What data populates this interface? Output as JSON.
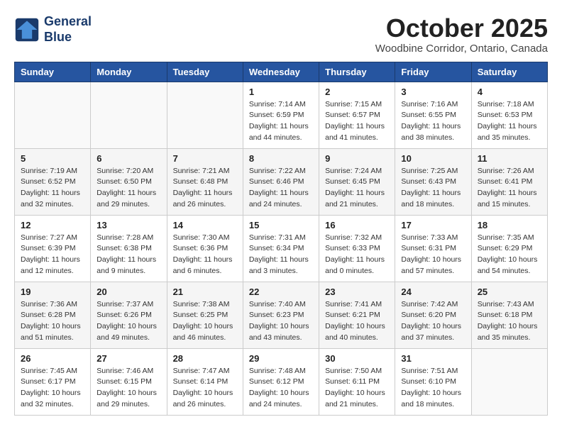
{
  "header": {
    "logo_line1": "General",
    "logo_line2": "Blue",
    "month": "October 2025",
    "location": "Woodbine Corridor, Ontario, Canada"
  },
  "weekdays": [
    "Sunday",
    "Monday",
    "Tuesday",
    "Wednesday",
    "Thursday",
    "Friday",
    "Saturday"
  ],
  "weeks": [
    [
      {
        "day": "",
        "info": ""
      },
      {
        "day": "",
        "info": ""
      },
      {
        "day": "",
        "info": ""
      },
      {
        "day": "1",
        "info": "Sunrise: 7:14 AM\nSunset: 6:59 PM\nDaylight: 11 hours and 44 minutes."
      },
      {
        "day": "2",
        "info": "Sunrise: 7:15 AM\nSunset: 6:57 PM\nDaylight: 11 hours and 41 minutes."
      },
      {
        "day": "3",
        "info": "Sunrise: 7:16 AM\nSunset: 6:55 PM\nDaylight: 11 hours and 38 minutes."
      },
      {
        "day": "4",
        "info": "Sunrise: 7:18 AM\nSunset: 6:53 PM\nDaylight: 11 hours and 35 minutes."
      }
    ],
    [
      {
        "day": "5",
        "info": "Sunrise: 7:19 AM\nSunset: 6:52 PM\nDaylight: 11 hours and 32 minutes."
      },
      {
        "day": "6",
        "info": "Sunrise: 7:20 AM\nSunset: 6:50 PM\nDaylight: 11 hours and 29 minutes."
      },
      {
        "day": "7",
        "info": "Sunrise: 7:21 AM\nSunset: 6:48 PM\nDaylight: 11 hours and 26 minutes."
      },
      {
        "day": "8",
        "info": "Sunrise: 7:22 AM\nSunset: 6:46 PM\nDaylight: 11 hours and 24 minutes."
      },
      {
        "day": "9",
        "info": "Sunrise: 7:24 AM\nSunset: 6:45 PM\nDaylight: 11 hours and 21 minutes."
      },
      {
        "day": "10",
        "info": "Sunrise: 7:25 AM\nSunset: 6:43 PM\nDaylight: 11 hours and 18 minutes."
      },
      {
        "day": "11",
        "info": "Sunrise: 7:26 AM\nSunset: 6:41 PM\nDaylight: 11 hours and 15 minutes."
      }
    ],
    [
      {
        "day": "12",
        "info": "Sunrise: 7:27 AM\nSunset: 6:39 PM\nDaylight: 11 hours and 12 minutes."
      },
      {
        "day": "13",
        "info": "Sunrise: 7:28 AM\nSunset: 6:38 PM\nDaylight: 11 hours and 9 minutes."
      },
      {
        "day": "14",
        "info": "Sunrise: 7:30 AM\nSunset: 6:36 PM\nDaylight: 11 hours and 6 minutes."
      },
      {
        "day": "15",
        "info": "Sunrise: 7:31 AM\nSunset: 6:34 PM\nDaylight: 11 hours and 3 minutes."
      },
      {
        "day": "16",
        "info": "Sunrise: 7:32 AM\nSunset: 6:33 PM\nDaylight: 11 hours and 0 minutes."
      },
      {
        "day": "17",
        "info": "Sunrise: 7:33 AM\nSunset: 6:31 PM\nDaylight: 10 hours and 57 minutes."
      },
      {
        "day": "18",
        "info": "Sunrise: 7:35 AM\nSunset: 6:29 PM\nDaylight: 10 hours and 54 minutes."
      }
    ],
    [
      {
        "day": "19",
        "info": "Sunrise: 7:36 AM\nSunset: 6:28 PM\nDaylight: 10 hours and 51 minutes."
      },
      {
        "day": "20",
        "info": "Sunrise: 7:37 AM\nSunset: 6:26 PM\nDaylight: 10 hours and 49 minutes."
      },
      {
        "day": "21",
        "info": "Sunrise: 7:38 AM\nSunset: 6:25 PM\nDaylight: 10 hours and 46 minutes."
      },
      {
        "day": "22",
        "info": "Sunrise: 7:40 AM\nSunset: 6:23 PM\nDaylight: 10 hours and 43 minutes."
      },
      {
        "day": "23",
        "info": "Sunrise: 7:41 AM\nSunset: 6:21 PM\nDaylight: 10 hours and 40 minutes."
      },
      {
        "day": "24",
        "info": "Sunrise: 7:42 AM\nSunset: 6:20 PM\nDaylight: 10 hours and 37 minutes."
      },
      {
        "day": "25",
        "info": "Sunrise: 7:43 AM\nSunset: 6:18 PM\nDaylight: 10 hours and 35 minutes."
      }
    ],
    [
      {
        "day": "26",
        "info": "Sunrise: 7:45 AM\nSunset: 6:17 PM\nDaylight: 10 hours and 32 minutes."
      },
      {
        "day": "27",
        "info": "Sunrise: 7:46 AM\nSunset: 6:15 PM\nDaylight: 10 hours and 29 minutes."
      },
      {
        "day": "28",
        "info": "Sunrise: 7:47 AM\nSunset: 6:14 PM\nDaylight: 10 hours and 26 minutes."
      },
      {
        "day": "29",
        "info": "Sunrise: 7:48 AM\nSunset: 6:12 PM\nDaylight: 10 hours and 24 minutes."
      },
      {
        "day": "30",
        "info": "Sunrise: 7:50 AM\nSunset: 6:11 PM\nDaylight: 10 hours and 21 minutes."
      },
      {
        "day": "31",
        "info": "Sunrise: 7:51 AM\nSunset: 6:10 PM\nDaylight: 10 hours and 18 minutes."
      },
      {
        "day": "",
        "info": ""
      }
    ]
  ]
}
